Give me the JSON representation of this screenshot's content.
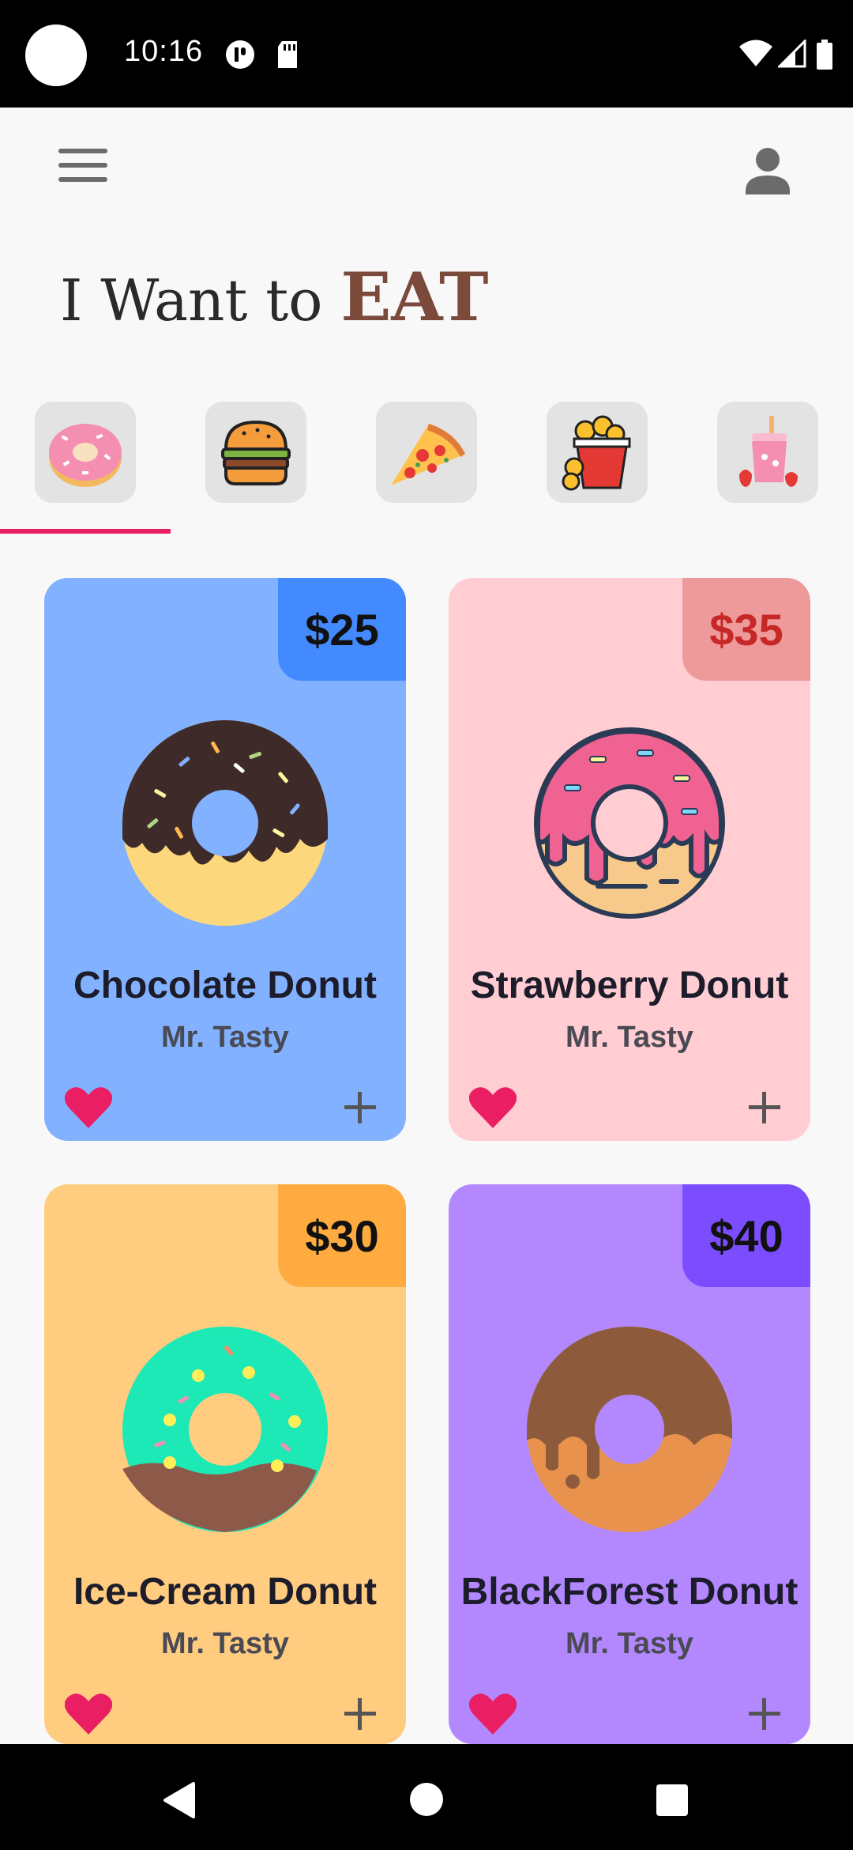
{
  "status_bar": {
    "time": "10:16"
  },
  "header": {
    "title_prefix": "I Want to",
    "title_emphasis": "EAT"
  },
  "categories": [
    {
      "icon": "donut-icon",
      "selected": true
    },
    {
      "icon": "burger-icon",
      "selected": false
    },
    {
      "icon": "pizza-icon",
      "selected": false
    },
    {
      "icon": "fried-chicken-icon",
      "selected": false
    },
    {
      "icon": "smoothie-icon",
      "selected": false
    }
  ],
  "items": [
    {
      "name": "Chocolate Donut",
      "maker": "Mr. Tasty",
      "price": "$25",
      "card_color": "#82b1ff",
      "tag_color": "#448aff",
      "price_color": "#111111"
    },
    {
      "name": "Strawberry Donut",
      "maker": "Mr. Tasty",
      "price": "$35",
      "card_color": "#ffcdd2",
      "tag_color": "#ef9a9a",
      "price_color": "#c62828"
    },
    {
      "name": "Ice-Cream Donut",
      "maker": "Mr. Tasty",
      "price": "$30",
      "card_color": "#ffcc80",
      "tag_color": "#ffab40",
      "price_color": "#111111"
    },
    {
      "name": "BlackForest Donut",
      "maker": "Mr. Tasty",
      "price": "$40",
      "card_color": "#b388ff",
      "tag_color": "#7c4dff",
      "price_color": "#111111"
    }
  ],
  "colors": {
    "accent": "#e91e63",
    "heart": "#e91e63",
    "eat": "#7b4a3b"
  }
}
